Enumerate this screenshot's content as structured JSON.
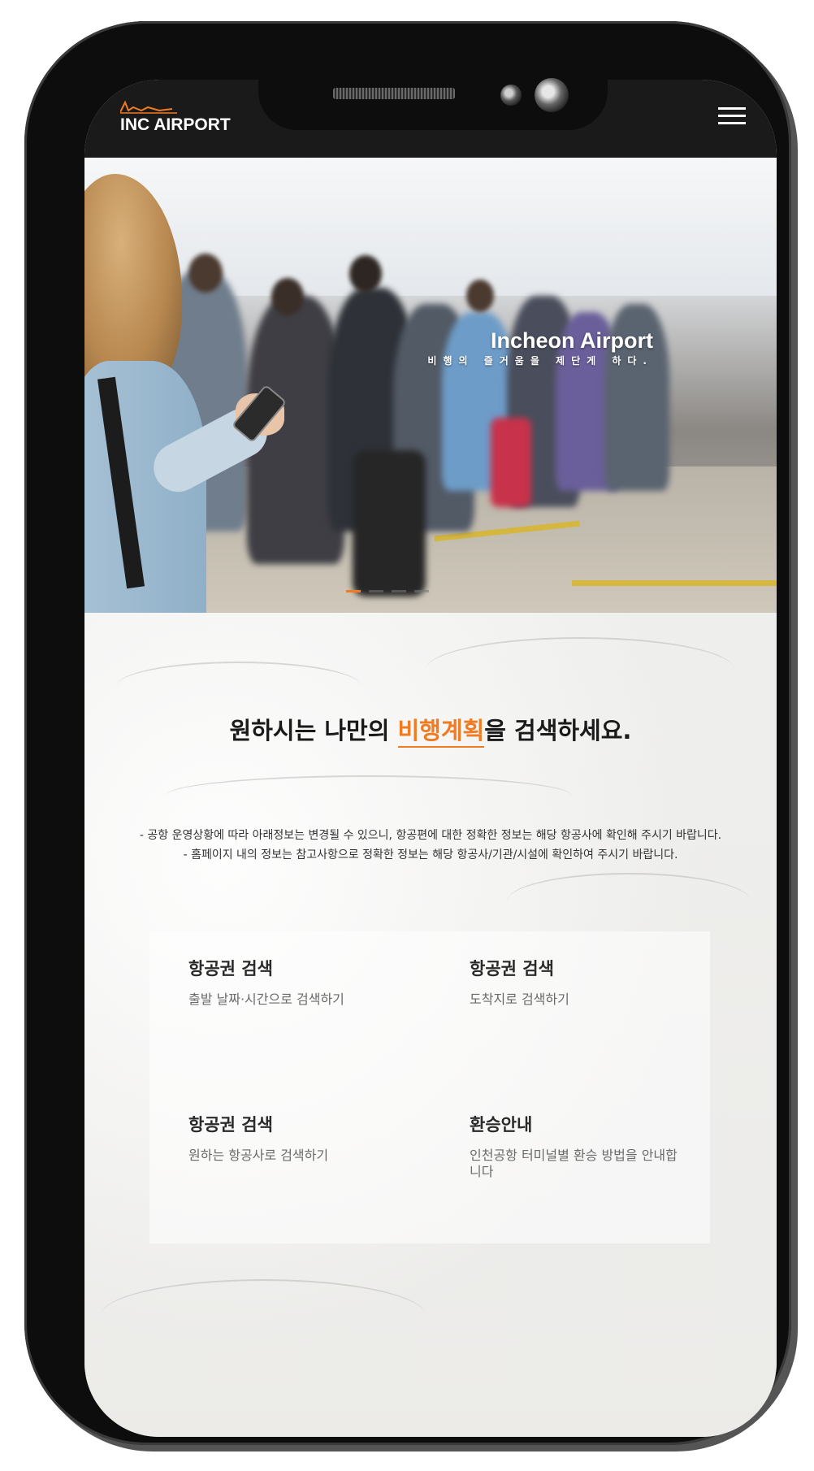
{
  "header": {
    "logo_text": "INC AIRPORT",
    "logo_accent": "#f07b23"
  },
  "hero": {
    "title": "Incheon Airport",
    "subtitle": "비행의 즐거움을 제단게 하다.",
    "slides": [
      {
        "active": true
      },
      {
        "active": false
      },
      {
        "active": false
      },
      {
        "active": false
      }
    ]
  },
  "main": {
    "headline_prefix": "원하시는 나만의 ",
    "headline_highlight": "비행계획",
    "headline_suffix": "을 검색하세요.",
    "notice_lines": [
      "- 공항 운영상황에 따라 아래정보는 변경될 수 있으니, 항공편에 대한 정확한 정보는 해당 항공사에 확인해 주시기 바랍니다.",
      "- 홈페이지 내의 정보는 참고사항으로 정확한 정보는 해당 항공사/기관/시설에 확인하여 주시기 바랍니다."
    ],
    "cards": [
      {
        "title": "항공권 검색",
        "desc": "출발 날짜·시간으로 검색하기"
      },
      {
        "title": "항공권 검색",
        "desc": "도착지로 검색하기"
      },
      {
        "title": "항공권 검색",
        "desc": "원하는 항공사로 검색하기"
      },
      {
        "title": "환승안내",
        "desc": "인천공항 터미널별 환승 방법을 안내합니다"
      }
    ]
  },
  "icons": {
    "menu": "hamburger-menu-icon",
    "logo": "flight-graph-logo-icon"
  },
  "colors": {
    "accent": "#f07b23",
    "header_bg": "#1a1a1a"
  }
}
